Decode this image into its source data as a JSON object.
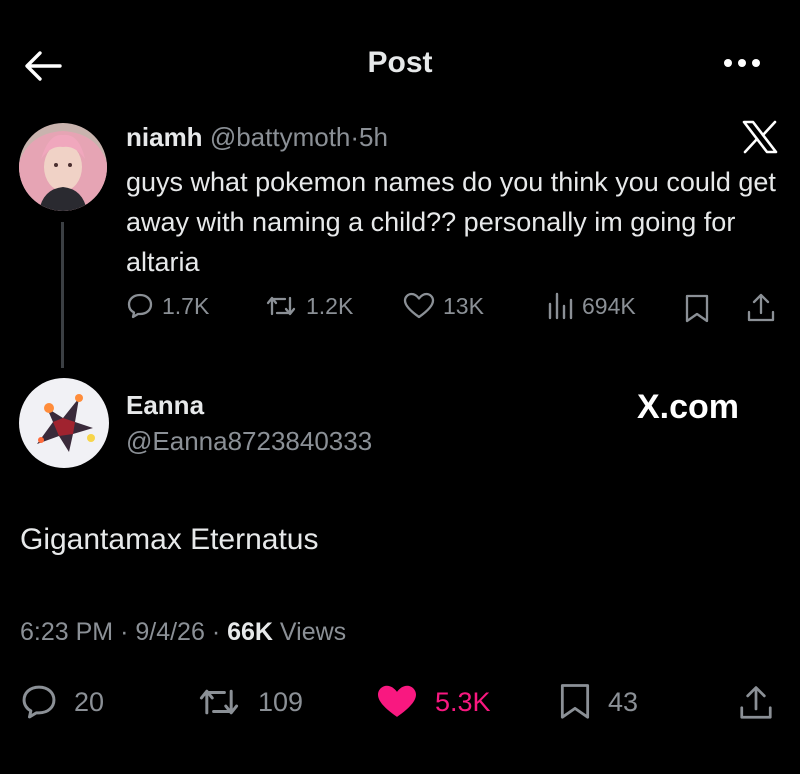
{
  "header": {
    "title": "Post",
    "back_icon": "arrow-left-icon",
    "more_icon": "ellipsis-icon"
  },
  "quoted_post": {
    "name": "niamh",
    "handle": "@battymoth",
    "separator": "·",
    "time": "5h",
    "text": "guys what pokemon names do you think you could get away with naming a child?? personally im going for altaria",
    "stats": {
      "replies": "1.7K",
      "reposts": "1.2K",
      "likes": "13K",
      "views": "694K"
    }
  },
  "reply": {
    "name": "Eanna",
    "handle": "@Eanna8723840333",
    "watermark": "X.com",
    "text": "Gigantamax Eternatus",
    "time": "6:23 PM",
    "date": "9/4/26",
    "separator": "·",
    "views_count": "66K",
    "views_label": "Views",
    "actions": {
      "replies": "20",
      "reposts": "109",
      "likes": "5.3K",
      "bookmarks": "43"
    }
  },
  "colors": {
    "background": "#000000",
    "text": "#e7e9ea",
    "muted": "#8b9096",
    "like": "#f91880",
    "thread_line": "#3b3f43"
  }
}
